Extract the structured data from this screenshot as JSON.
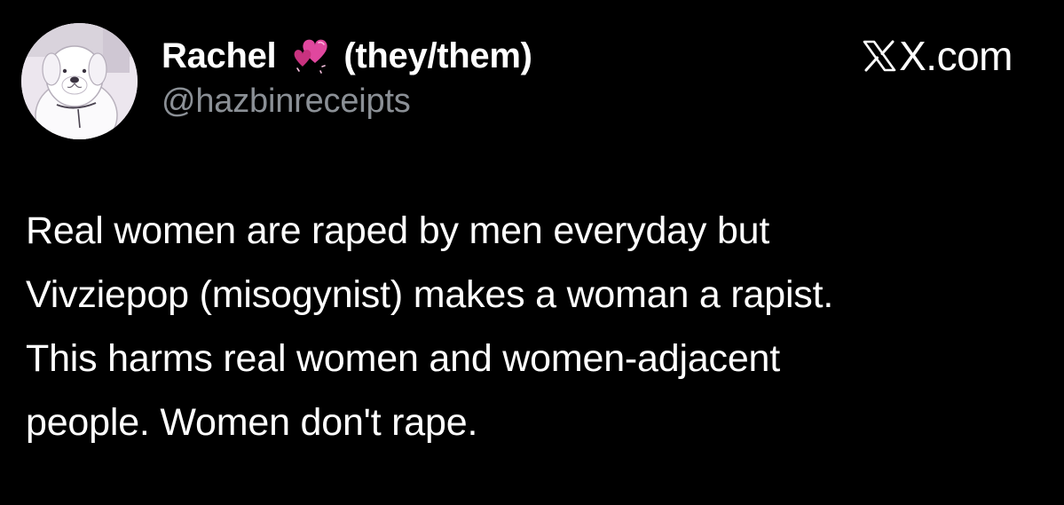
{
  "author": {
    "display_name": "Rachel",
    "emoji_icon": "two-hearts-icon",
    "pronouns": "(they/them)",
    "handle": "@hazbinreceipts",
    "avatar_icon": "white-dog-avatar"
  },
  "brand": {
    "logo_icon": "x-logo-icon",
    "label": "X.com"
  },
  "post": {
    "lines": [
      "Real women are raped by men everyday but",
      "Vivziepop (misogynist) makes a woman a rapist.",
      "This harms real women and women-adjacent",
      "people. Women don't rape."
    ]
  },
  "colors": {
    "background": "#000000",
    "text": "#ffffff",
    "handle": "#8b9096",
    "heart": "#e0479e"
  }
}
